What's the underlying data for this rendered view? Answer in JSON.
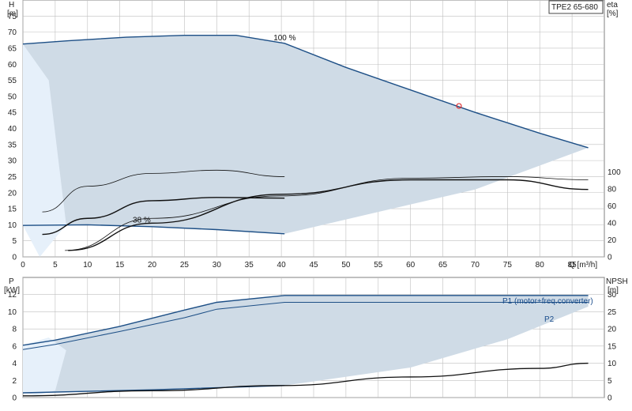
{
  "colors": {
    "band": "#cfdbe6",
    "band_light": "#e6f0fa",
    "curve": "#1d4f86",
    "eff": "#111111",
    "grid": "#bfbfbf",
    "marker": "#e03030"
  },
  "model": "TPE2 65-680",
  "chart_data": [
    {
      "type": "line",
      "name": "pump-curve",
      "y_left": {
        "label": "H",
        "unit": "[m]",
        "ticks": [
          0,
          5,
          10,
          15,
          20,
          25,
          30,
          35,
          40,
          45,
          50,
          55,
          60,
          65,
          70,
          75
        ],
        "ylim": [
          0,
          80
        ]
      },
      "y_right": {
        "label": "eta",
        "unit": "[%]",
        "ticks": [
          0,
          20,
          40,
          60,
          80,
          100
        ],
        "ylim": [
          0,
          100
        ],
        "maps_to_h": [
          0,
          26.5
        ]
      },
      "x": {
        "label": "Q [m³/h]",
        "ticks": [
          0,
          5,
          10,
          15,
          20,
          25,
          30,
          35,
          40,
          45,
          50,
          55,
          60,
          65,
          70,
          75,
          80,
          85
        ],
        "xlim": [
          0,
          90
        ]
      },
      "grid": true,
      "annotations": [
        {
          "text": "100 %",
          "x": 40.5,
          "y": 67
        },
        {
          "text": "38 %",
          "x": 17,
          "y": 11
        }
      ],
      "duty_point": {
        "x": 67.5,
        "y": 47
      },
      "series": [
        {
          "role": "H-max",
          "x": [
            0,
            7,
            16,
            25,
            33,
            40.5,
            50,
            60,
            70,
            80,
            87.5
          ],
          "y": [
            66.3,
            67.3,
            68.4,
            69,
            69,
            66.5,
            59,
            52,
            45,
            38.5,
            34
          ]
        },
        {
          "role": "H-min",
          "x": [
            0,
            10,
            20,
            30,
            40.5
          ],
          "y": [
            9.8,
            10,
            9.4,
            8.5,
            7.2
          ]
        },
        {
          "role": "band-left",
          "x": [
            0,
            4,
            6.7,
            2.6,
            0
          ],
          "y": [
            66.3,
            55,
            10,
            0,
            9.8
          ]
        },
        {
          "role": "eta-curve",
          "x": [
            3,
            10,
            20,
            30,
            40.5
          ],
          "y": [
            14,
            22,
            26,
            27,
            25
          ]
        },
        {
          "role": "eta-curve",
          "x": [
            3,
            10,
            20,
            30,
            40.5
          ],
          "y": [
            7,
            12,
            17.5,
            18.5,
            18.3
          ]
        },
        {
          "role": "eta-curve",
          "x": [
            6.5,
            20,
            40,
            60,
            75,
            87.5
          ],
          "y": [
            2,
            12,
            19,
            24.5,
            25,
            24
          ]
        },
        {
          "role": "eta-curve",
          "x": [
            7,
            20,
            40,
            60,
            75,
            87.5
          ],
          "y": [
            2,
            10.5,
            19.5,
            24,
            24,
            21
          ]
        }
      ]
    },
    {
      "type": "line",
      "name": "power-npsh-curve",
      "y_left": {
        "label": "P",
        "unit": "[kW]",
        "ticks": [
          0,
          2,
          4,
          6,
          8,
          10,
          12
        ],
        "ylim": [
          0,
          14
        ]
      },
      "y_right": {
        "label": "NPSH",
        "unit": "[m]",
        "ticks": [
          0,
          5,
          10,
          15,
          20,
          25,
          30
        ],
        "ylim": [
          0,
          35
        ]
      },
      "x": {
        "xlim": [
          0,
          90
        ]
      },
      "grid": true,
      "series": [
        {
          "name": "P1 (motor+freq.converter)",
          "x": [
            0,
            5,
            15,
            25,
            30,
            40.5,
            87.5
          ],
          "y": [
            6.1,
            6.7,
            8.3,
            10.2,
            11.1,
            11.9,
            11.9
          ]
        },
        {
          "name": "P2",
          "x": [
            0,
            5,
            15,
            25,
            30,
            40.5,
            87.5
          ],
          "y": [
            5.6,
            6.2,
            7.7,
            9.3,
            10.3,
            11.1,
            11.1
          ]
        },
        {
          "role": "P-min",
          "x": [
            0,
            20,
            40.5
          ],
          "y": [
            0.55,
            0.9,
            1.4
          ]
        },
        {
          "role": "npsh",
          "x": [
            0,
            20,
            40,
            60,
            80,
            87.5
          ],
          "y": [
            0.5,
            2,
            3.5,
            6,
            8.5,
            10
          ]
        },
        {
          "role": "band-left",
          "x": [
            0,
            2,
            5,
            6.7,
            4,
            0
          ],
          "y": [
            0.6,
            0.2,
            0.8,
            5.5,
            7,
            6.1
          ]
        }
      ]
    }
  ]
}
